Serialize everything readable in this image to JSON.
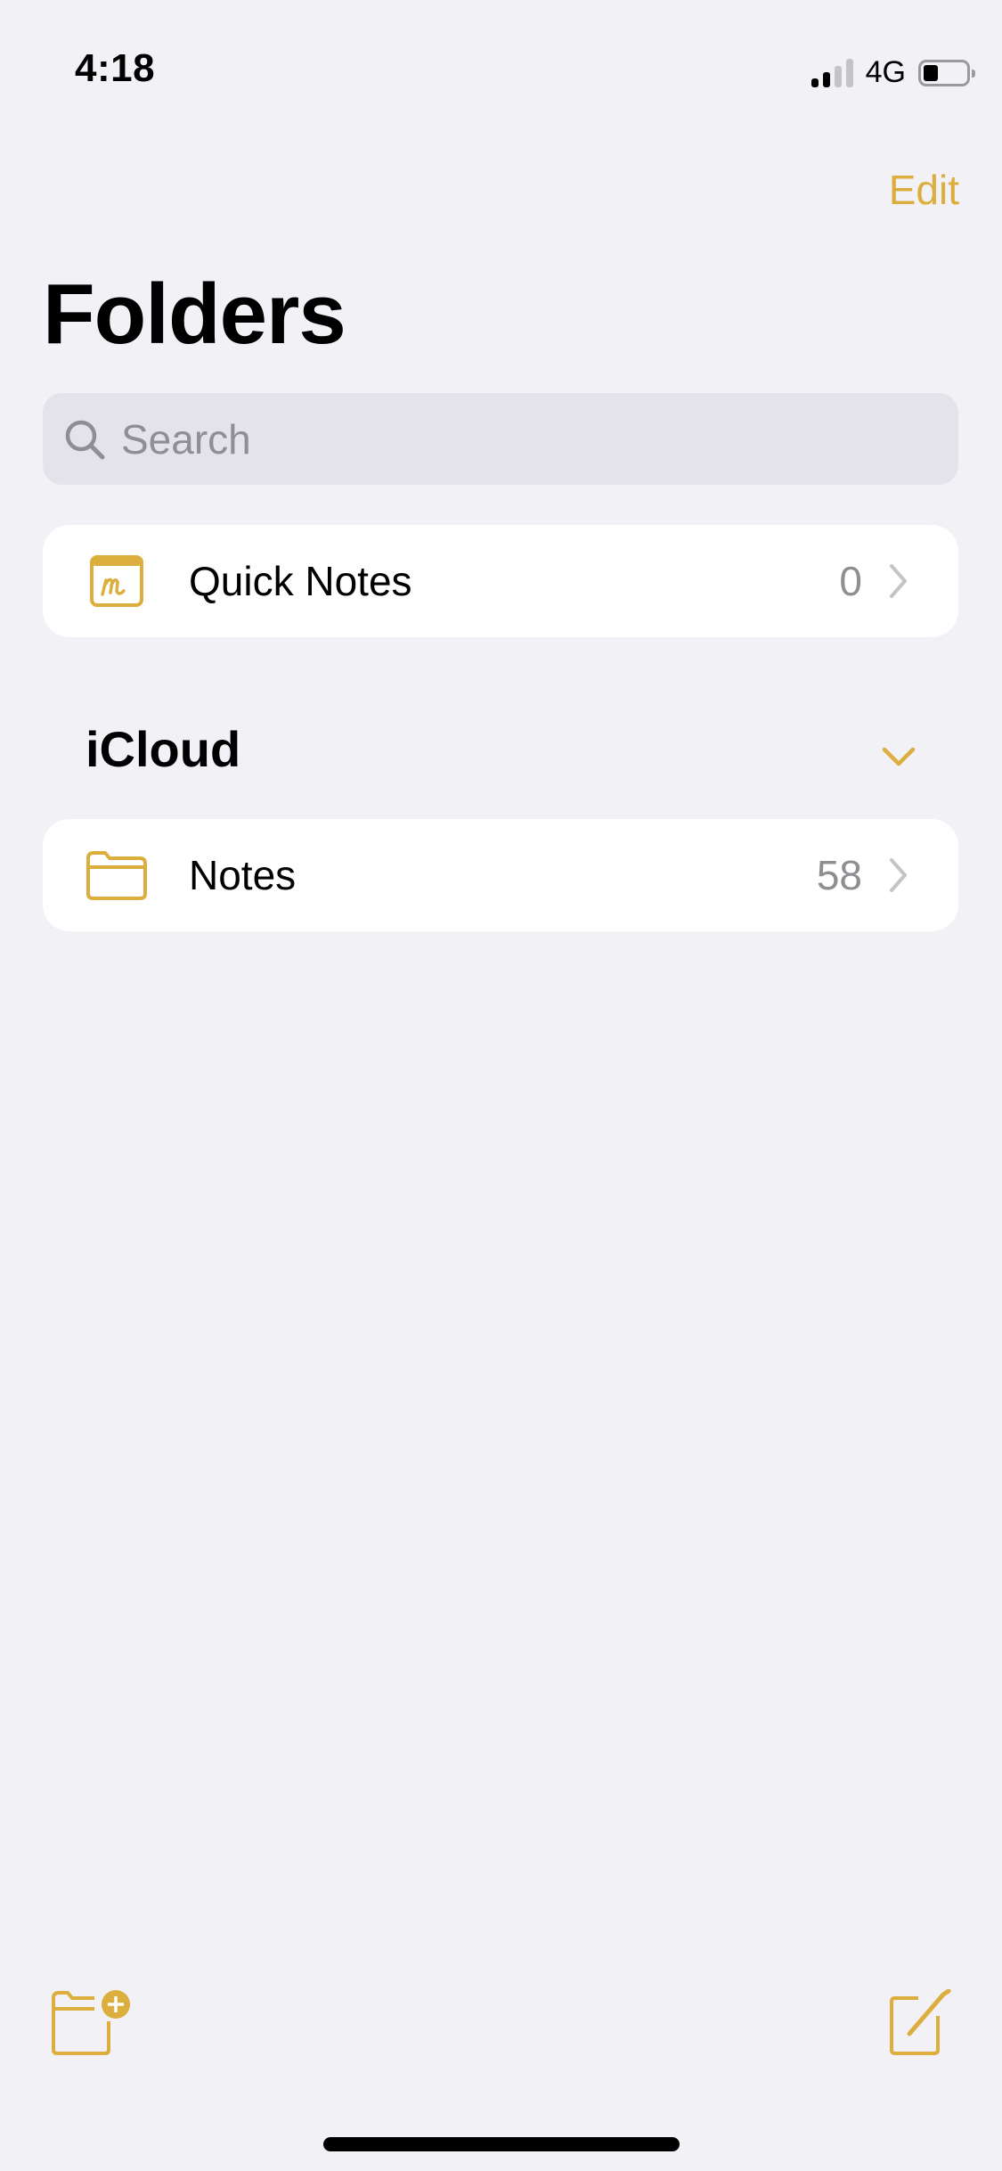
{
  "status_bar": {
    "time": "4:18",
    "network": "4G",
    "signal_bars_active": 2,
    "signal_bars_total": 4,
    "battery_level_fraction": 0.3
  },
  "nav": {
    "edit_label": "Edit"
  },
  "header": {
    "title": "Folders"
  },
  "search": {
    "placeholder": "Search",
    "value": ""
  },
  "quick_notes": {
    "label": "Quick Notes",
    "count": "0",
    "icon": "quick-notes-icon"
  },
  "icloud": {
    "section_title": "iCloud",
    "folders": [
      {
        "label": "Notes",
        "count": "58",
        "icon": "folder-icon"
      }
    ]
  },
  "toolbar": {
    "new_folder_icon": "new-folder-icon",
    "compose_icon": "compose-icon"
  },
  "colors": {
    "accent": "#dcae3d",
    "background": "#f2f1f6",
    "card": "#ffffff",
    "secondary_text": "#8e8e93"
  }
}
